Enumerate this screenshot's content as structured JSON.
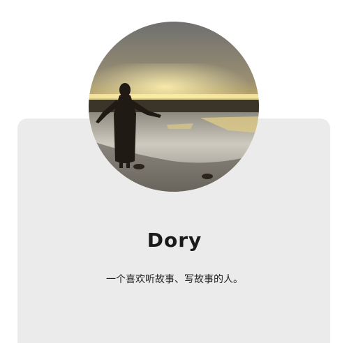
{
  "profile": {
    "name": "Dory",
    "bio": "一个喜欢听故事、写故事的人。",
    "avatar_icon": "avatar-photo-sunset-silhouette"
  },
  "colors": {
    "card_background": "#ebebeb",
    "page_background": "#ffffff",
    "name_color": "#1a1a1a"
  }
}
